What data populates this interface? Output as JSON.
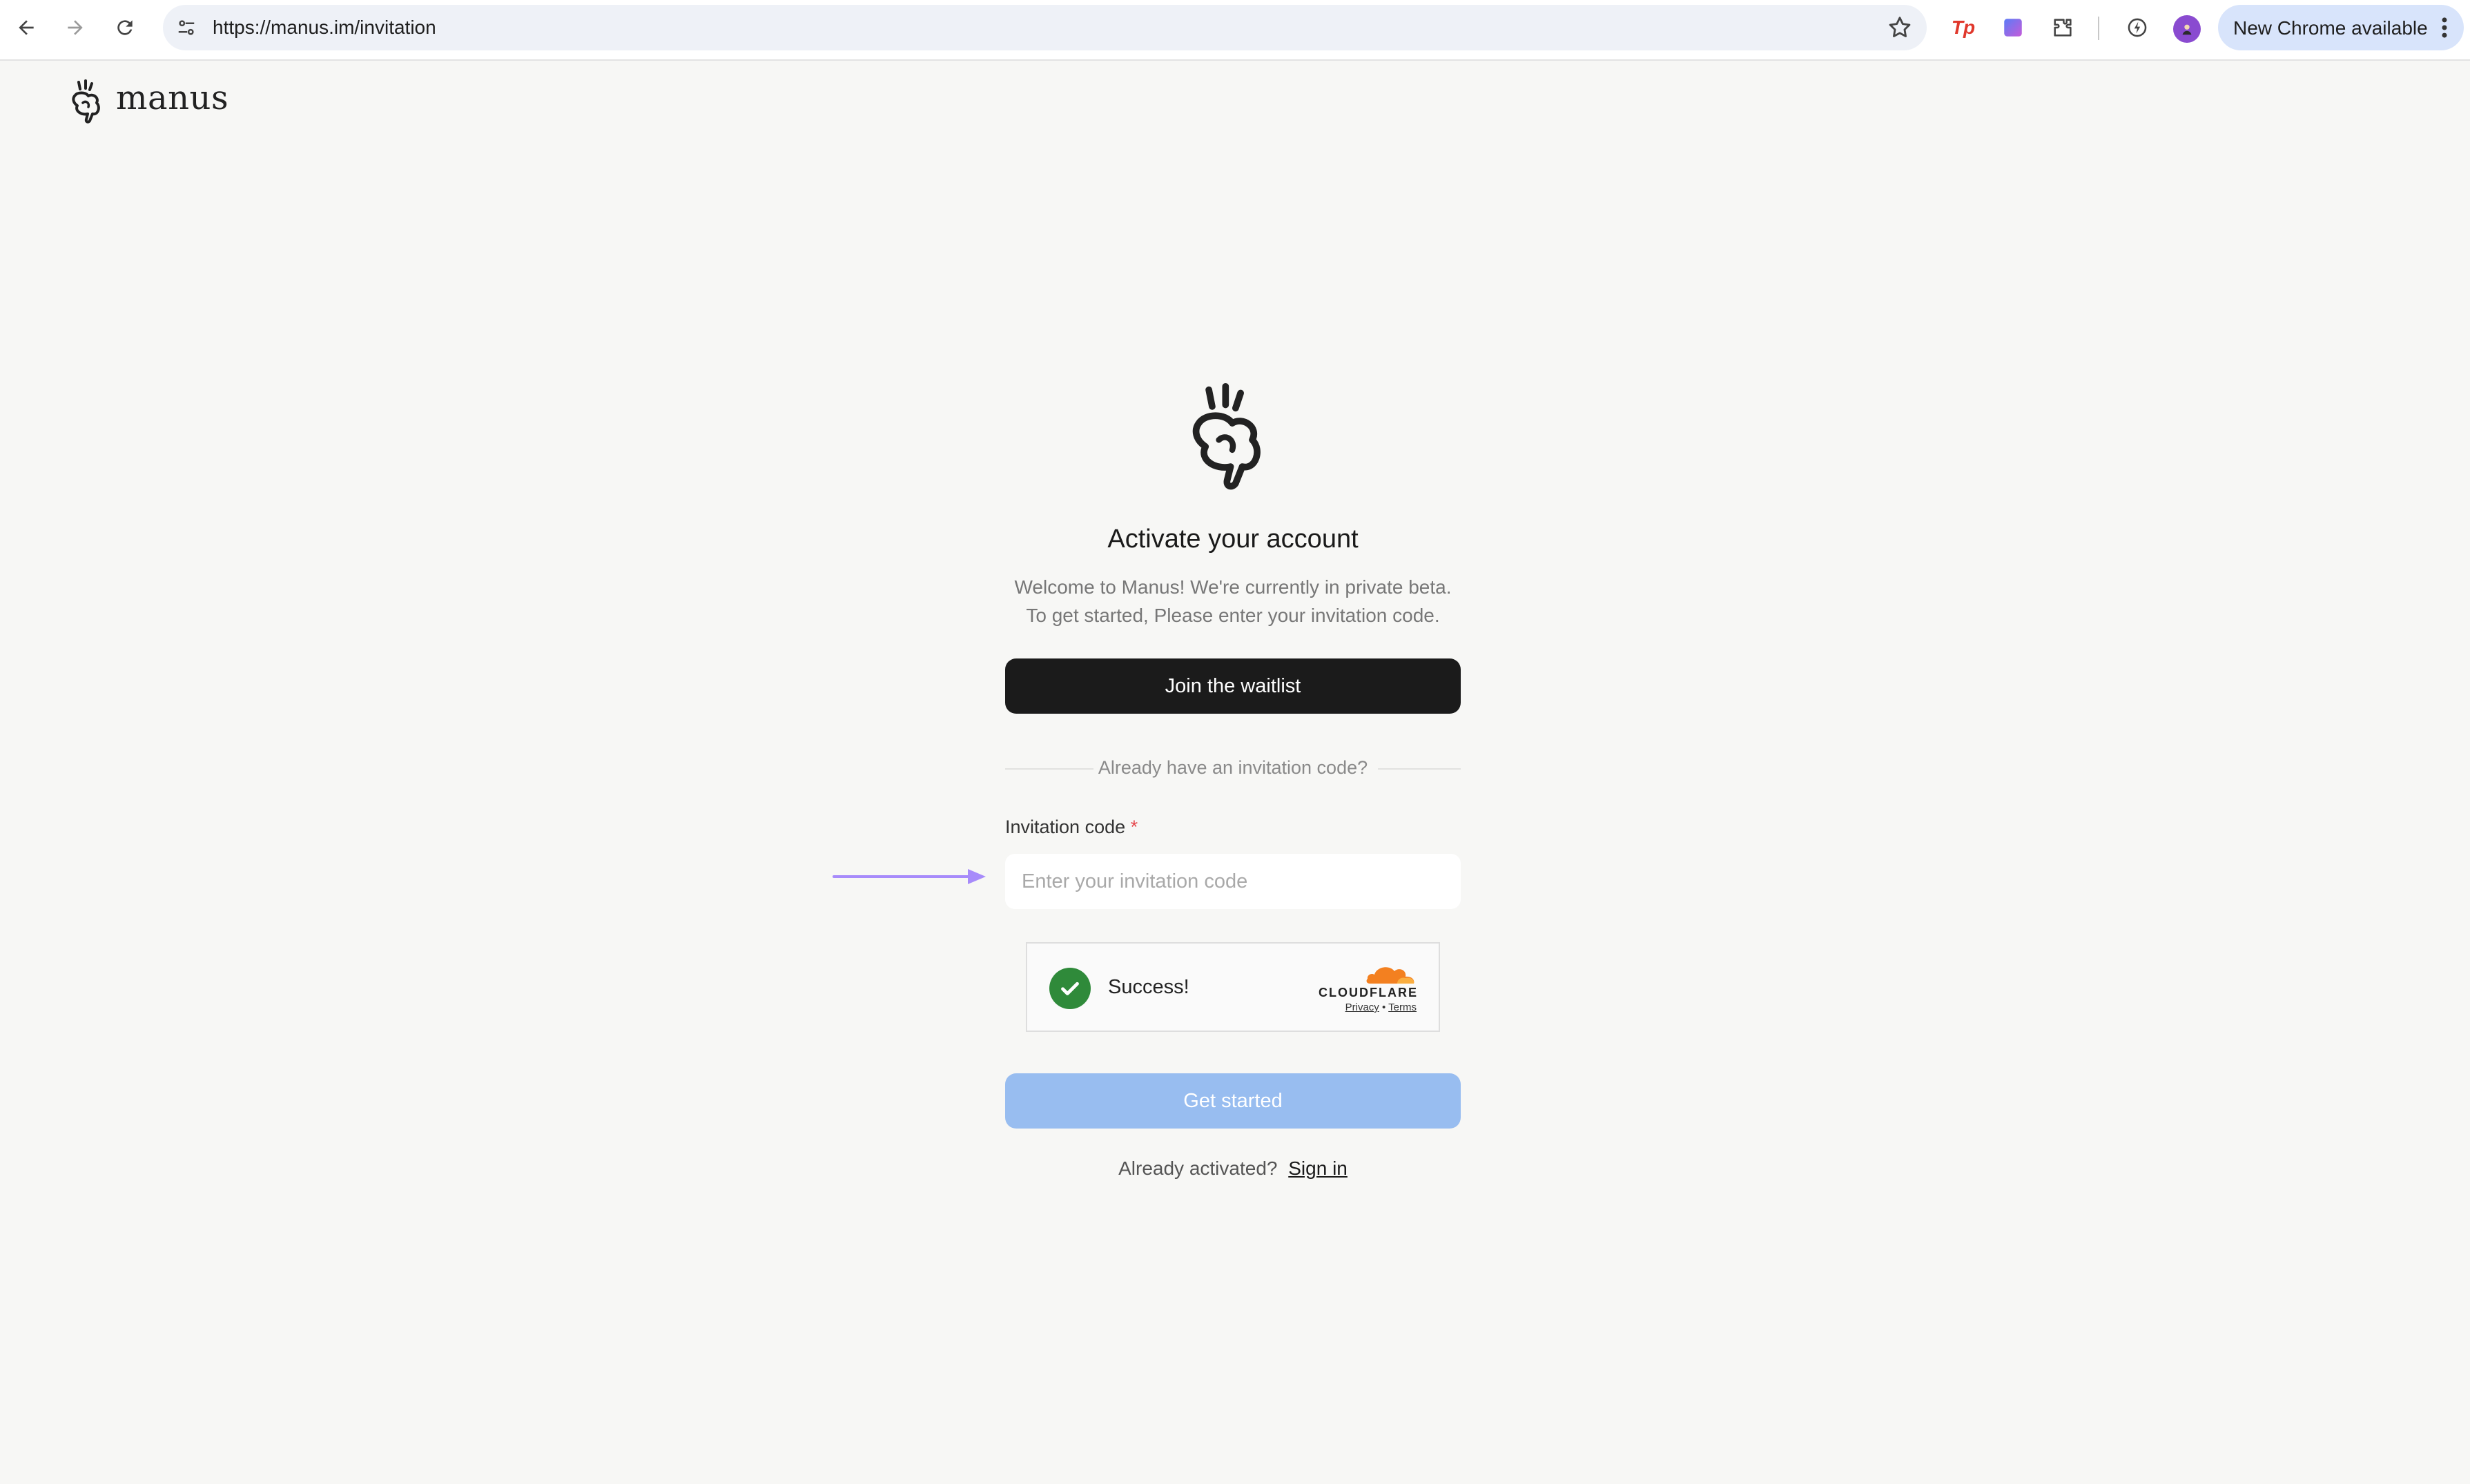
{
  "browser": {
    "url": "https://manus.im/invitation",
    "update_label": "New Chrome available",
    "extensions": [
      "tp-extension-icon",
      "color-extension-icon",
      "puzzle-extension-icon",
      "performance-icon"
    ],
    "tp_label": "Tp"
  },
  "header": {
    "brand_name": "manus"
  },
  "main": {
    "title": "Activate your account",
    "subtitle_line1": "Welcome to Manus! We're currently in private beta.",
    "subtitle_line2": "To get started, Please enter your invitation code.",
    "waitlist_label": "Join the waitlist",
    "divider_text": "Already have an invitation code?",
    "code_label": "Invitation code",
    "code_required_mark": "*",
    "code_placeholder": "Enter your invitation code",
    "code_value": "",
    "start_label": "Get started",
    "signin_prompt": "Already activated?",
    "signin_link": "Sign in"
  },
  "captcha": {
    "status": "Success!",
    "provider": "CLOUDFLARE",
    "privacy": "Privacy",
    "separator": "•",
    "terms": "Terms"
  },
  "colors": {
    "background": "#f7f7f5",
    "primary_button": "#1b1b1b",
    "disabled_button": "#98bdf0",
    "success_green": "#2f8a3a",
    "arrow_purple": "#a78bfa",
    "required_red": "#e5484d"
  }
}
